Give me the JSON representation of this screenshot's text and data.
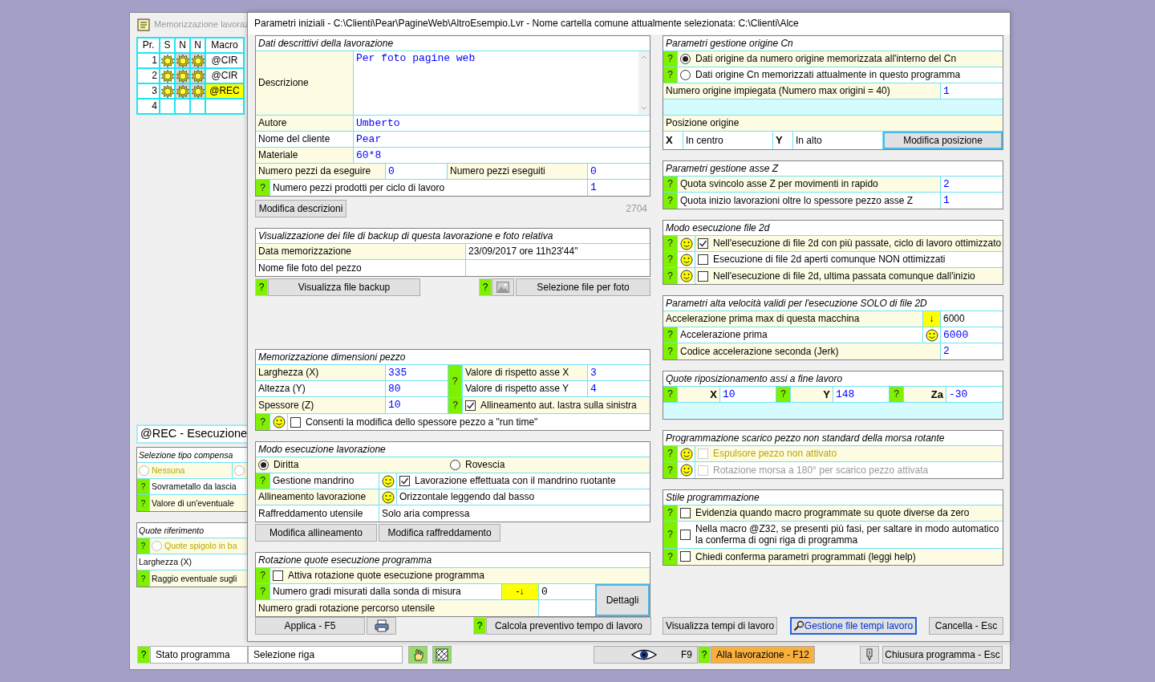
{
  "desktop_window": {
    "title": "Memorizzazione lavoraz",
    "program_table": {
      "columns": [
        "Pr.",
        "S",
        "N",
        "N",
        "Macro"
      ],
      "rows": [
        {
          "number": "1",
          "flags": [
            true,
            true,
            true
          ],
          "macro": "@CIR",
          "selected": false
        },
        {
          "number": "2",
          "flags": [
            true,
            true,
            true
          ],
          "macro": "@CIR",
          "selected": false
        },
        {
          "number": "3",
          "flags": [
            true,
            true,
            true
          ],
          "macro": "@REC",
          "selected": true
        },
        {
          "number": "4",
          "flags": [
            false,
            false,
            false
          ],
          "selected": false
        }
      ]
    },
    "macro_title": "@REC - Esecuzione",
    "compensation": {
      "title": "Selezione tipo compensa",
      "options": [
        {
          "label": "Nessuna",
          "selected": false
        },
        {
          "selected": false
        }
      ],
      "rows": [
        {
          "help": "?",
          "label": "Sovrametallo da lascia"
        },
        {
          "help": "?",
          "label": "Valore di un'eventuale"
        }
      ]
    },
    "reference": {
      "title": "Quote riferimento",
      "option": {
        "help": "?",
        "label": "Quote spigolo in ba",
        "selected": false
      },
      "rows": [
        {
          "label": "Larghezza (X)"
        },
        {
          "help": "?",
          "label": "Raggio eventuale sugli"
        }
      ]
    },
    "status_bar": {
      "help": "?",
      "label": "Stato programma",
      "value": "Selezione riga",
      "view_key": "F9",
      "run_help": "?",
      "run_button": "Alla lavorazione - F12",
      "close_button": "Chiusura programma - Esc"
    }
  },
  "dialog": {
    "title": "Parametri iniziali - C:\\Clienti\\Pear\\PagineWeb\\AltroEsempio.Lvr - Nome cartella comune attualmente selezionata: C:\\Clienti\\Alce",
    "description_panel": {
      "title": "Dati descrittivi della lavorazione",
      "fields": [
        {
          "label": "Descrizione",
          "value": "Per foto pagine web"
        },
        {
          "label": "Autore",
          "value": "Umberto"
        },
        {
          "label": "Nome del cliente",
          "value": "Pear"
        },
        {
          "label": "Materiale",
          "value": "60*8"
        }
      ],
      "pieces_to_make": {
        "label": "Numero pezzi da eseguire",
        "value": "0"
      },
      "pieces_done": {
        "label": "Numero pezzi eseguiti",
        "value": "0"
      },
      "pieces_per_cycle": {
        "help": "?",
        "label": "Numero pezzi prodotti per ciclo di lavoro",
        "value": "1"
      },
      "edit_button": "Modifica descrizioni",
      "code": "2704"
    },
    "backup_panel": {
      "title": "Visualizzazione dei file di backup di questa lavorazione e foto relativa",
      "rows": [
        {
          "label": "Data memorizzazione",
          "value": "23/09/2017 ore 11h23'44\""
        },
        {
          "label": "Nome file foto del pezzo"
        }
      ],
      "view_help": "?",
      "view_button": "Visualizza file backup",
      "photo_help": "?",
      "photo_button": "Selezione file per foto"
    },
    "dimensions_panel": {
      "title": "Memorizzazione dimensioni pezzo",
      "sizes": [
        {
          "label": "Larghezza (X)",
          "value": "335"
        },
        {
          "label": "Altezza (Y)",
          "value": "80"
        },
        {
          "label": "Spessore (Z)",
          "value": "10"
        }
      ],
      "tolerance_help": "?",
      "tolerances": [
        {
          "label": "Valore di rispetto asse X",
          "value": "3"
        },
        {
          "label": "Valore di rispetto asse Y",
          "value": "4"
        }
      ],
      "auto_align": {
        "help": "?",
        "label": "Allineamento aut. lastra sulla sinistra",
        "checked": true
      },
      "runtime_edit": {
        "help": "?",
        "label": "Consenti la modifica dello spessore pezzo a \"run time\"",
        "checked": false
      }
    },
    "mode_panel": {
      "title": "Modo esecuzione lavorazione",
      "directions": [
        {
          "label": "Diritta",
          "selected": true
        },
        {
          "label": "Rovescia",
          "selected": false
        }
      ],
      "spindle": {
        "help": "?",
        "label": "Gestione mandrino",
        "option": "Lavorazione effettuata con il mandrino ruotante",
        "checked": true
      },
      "alignment": {
        "label": "Allineamento lavorazione",
        "value": "Orizzontale leggendo dal basso"
      },
      "cooling": {
        "label": "Raffreddamento utensile",
        "value": "Solo aria compressa"
      },
      "buttons": [
        "Modifica allineamento",
        "Modifica raffreddamento"
      ]
    },
    "rotation_panel": {
      "title": "Rotazione quote esecuzione programma",
      "enable": {
        "help": "?",
        "label": "Attiva rotazione quote esecuzione programma",
        "checked": false
      },
      "probe": {
        "help": "?",
        "label": "Numero gradi misurati dalla sonda di misura",
        "arrow": "-↓",
        "value": "0"
      },
      "toolpath": {
        "label": "Numero gradi rotazione percorso utensile"
      },
      "details_button": "Dettagli"
    },
    "footer_left": {
      "apply_button": "Applica - F5",
      "estimate_help": "?",
      "estimate_button": "Calcola preventivo tempo di lavoro"
    },
    "origin_panel": {
      "title": "Parametri gestione origine Cn",
      "sources": [
        {
          "help": "?",
          "label": "Dati origine da numero origine memorizzata all'interno del Cn",
          "selected": true
        },
        {
          "help": "?",
          "label": "Dati origine Cn memorizzati attualmente in questo programma",
          "selected": false
        }
      ],
      "origin_number": {
        "label": "Numero origine impiegata (Numero max origini = 40)",
        "value": "1"
      },
      "position_label": "Posizione origine",
      "x": {
        "axis": "X",
        "value": "In centro"
      },
      "y": {
        "axis": "Y",
        "value": "In alto"
      },
      "edit_button": "Modifica posizione"
    },
    "z_panel": {
      "title": "Parametri gestione asse Z",
      "rows": [
        {
          "help": "?",
          "label": "Quota svincolo asse Z per movimenti in rapido",
          "value": "2"
        },
        {
          "help": "?",
          "label": "Quota inizio lavorazioni oltre lo spessore pezzo asse Z",
          "value": "1"
        }
      ]
    },
    "file2d_panel": {
      "title": "Modo esecuzione file 2d",
      "options": [
        {
          "help": "?",
          "label": "Nell'esecuzione di file 2d con più passate, ciclo di lavoro ottimizzato",
          "checked": true
        },
        {
          "help": "?",
          "label": "Esecuzione di file 2d aperti comunque NON ottimizzati",
          "checked": false
        },
        {
          "help": "?",
          "label": "Nell'esecuzione di file 2d, ultima passata comunque dall'inizio",
          "checked": false
        }
      ]
    },
    "speed_panel": {
      "title": "Parametri alta velocità validi per l'esecuzione SOLO di file 2D",
      "rows": [
        {
          "kind": "limit",
          "label": "Accelerazione prima max di questa macchina",
          "arrow": "↓",
          "value": "6000"
        },
        {
          "kind": "smiley",
          "help": "?",
          "label": "Accelerazione prima",
          "value": "6000"
        },
        {
          "kind": "plain",
          "help": "?",
          "label": "Codice accelerazione seconda (Jerk)",
          "value": "2"
        }
      ]
    },
    "return_panel": {
      "title": "Quote riposizionamento assi a fine lavoro",
      "axes": [
        {
          "help": "?",
          "axis": "X",
          "value": "10"
        },
        {
          "help": "?",
          "axis": "Y",
          "value": "148"
        },
        {
          "help": "?",
          "axis": "Za",
          "value": "-30"
        }
      ]
    },
    "unload_panel": {
      "title": "Programmazione scarico pezzo non standard della morsa rotante",
      "options": [
        {
          "help": "?",
          "label": "Espulsore pezzo non attivato",
          "checked": false,
          "disabled": true
        },
        {
          "help": "?",
          "label": "Rotazione morsa a 180° per scarico pezzo attivata",
          "checked": false,
          "disabled": true
        }
      ]
    },
    "style_panel": {
      "title": "Stile programmazione",
      "options": [
        {
          "help": "?",
          "label": "Evidenzia quando macro programmate su quote diverse da zero",
          "checked": false
        },
        {
          "help": "?",
          "label": "Nella macro @Z32, se presenti più fasi, per saltare in modo automatico la conferma di ogni riga di programma",
          "checked": false
        },
        {
          "help": "?",
          "label": "Chiedi conferma parametri programmati (leggi help)",
          "checked": false
        }
      ]
    },
    "footer_right": {
      "times_button": "Visualizza tempi di lavoro",
      "manage_button": "Gestione file tempi lavoro",
      "cancel_button": "Cancella - Esc"
    }
  }
}
